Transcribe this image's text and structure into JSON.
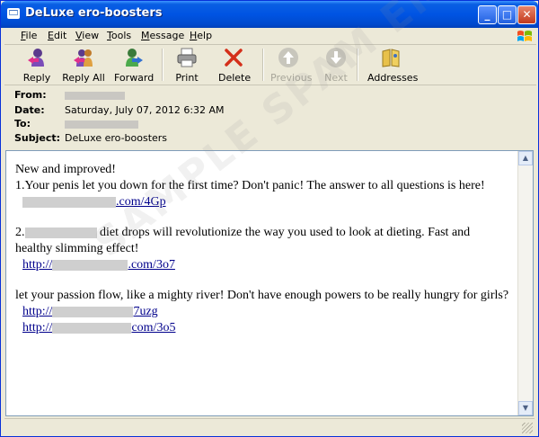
{
  "window": {
    "title": "DeLuxe ero-boosters"
  },
  "menu": [
    {
      "key": "F",
      "rest": "ile"
    },
    {
      "key": "E",
      "rest": "dit"
    },
    {
      "key": "V",
      "rest": "iew"
    },
    {
      "key": "T",
      "rest": "ools"
    },
    {
      "key": "M",
      "rest": "essage"
    },
    {
      "key": "H",
      "rest": "elp"
    }
  ],
  "toolbar": {
    "reply": "Reply",
    "reply_all": "Reply All",
    "forward": "Forward",
    "print": "Print",
    "delete": "Delete",
    "previous": "Previous",
    "next": "Next",
    "addresses": "Addresses"
  },
  "header": {
    "from_label": "From:",
    "date_label": "Date:",
    "date_value": "Saturday, July 07, 2012 6:32 AM",
    "to_label": "To:",
    "subject_label": "Subject:",
    "subject_value": "DeLuxe ero-boosters"
  },
  "body": {
    "line1": "New and improved!",
    "line2": "1.Your penis let you down for the first time? Don't panic! The answer to all questions is here!",
    "link1_suffix": ".com/4Gp",
    "line3_prefix": "2.",
    "line3_rest": " diet drops will revolutionize the way you used to look at dieting. Fast and healthy slimming effect!",
    "link2_prefix": "http://",
    "link2_suffix": ".com/3o7",
    "line4": "let your passion flow, like a mighty river! Don't have enough powers to be really hungry for girls?",
    "link3_prefix": "http://",
    "link3_suffix": "7uzg",
    "link4_prefix": "http://",
    "link4_suffix": "com/3o5"
  },
  "watermark": "SAMPLE SPAM EMAIL",
  "colors": {
    "titlebar": "#0054e3",
    "link": "#00008b",
    "delete_red": "#d42f1a"
  }
}
